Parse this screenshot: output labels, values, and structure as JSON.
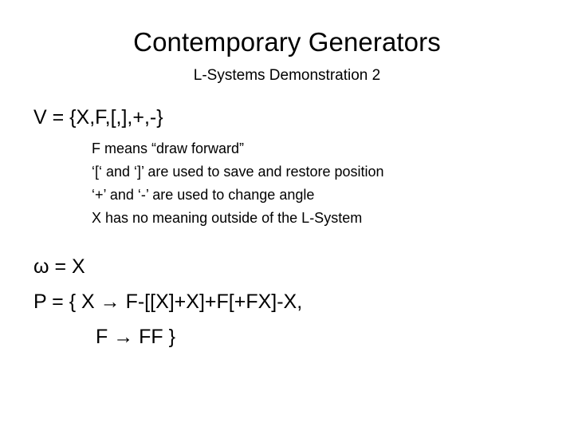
{
  "slide": {
    "title": "Contemporary Generators",
    "subtitle": "L-Systems Demonstration 2",
    "alphabet_line": "V = {X,F,[,],+,-}",
    "notes": [
      "F means “draw forward”",
      "‘[‘ and ‘]’ are used to save and restore position",
      "‘+’ and ‘-’ are used to change angle",
      "X has no meaning outside of the L-System"
    ],
    "axiom_line": "ω = X",
    "production_line_1": "P = { X → F-[[X]+X]+F[+FX]-X,",
    "production_line_2": "F → FF }"
  },
  "colors": {
    "background": "#ffffff",
    "text": "#000000"
  }
}
